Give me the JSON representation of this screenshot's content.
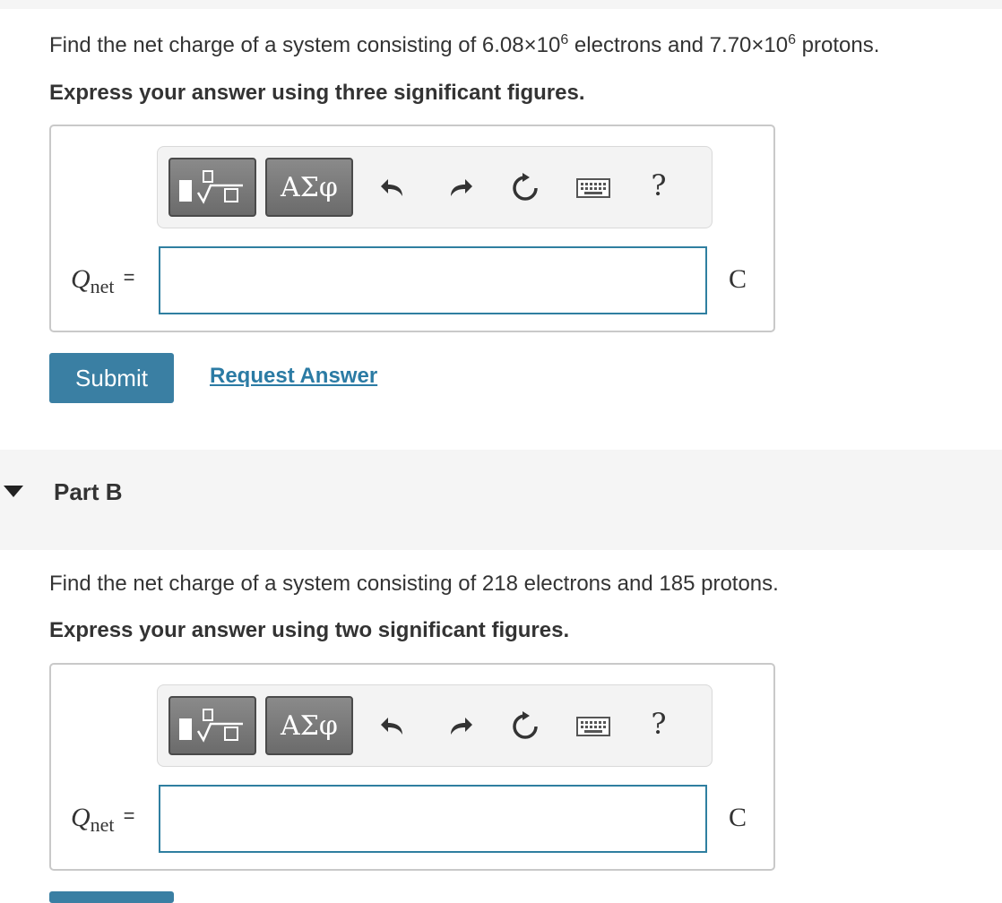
{
  "partA": {
    "question_prefix": "Find the net charge of a system consisting of 6.08×10",
    "question_exp1": "6",
    "question_mid": " electrons and 7.70×10",
    "question_exp2": "6",
    "question_suffix": " protons.",
    "instruction": "Express your answer using three significant figures.",
    "variable": "Q",
    "variable_sub": "net",
    "equals": "=",
    "answer_value": "",
    "unit": "C",
    "submit_label": "Submit",
    "request_label": "Request Answer"
  },
  "partB": {
    "title": "Part B",
    "question": "Find the net charge of a system consisting of 218 electrons and 185 protons.",
    "instruction": "Express your answer using two significant figures.",
    "variable": "Q",
    "variable_sub": "net",
    "equals": "=",
    "answer_value": "",
    "unit": "C"
  },
  "toolbar": {
    "symbols_label": "ΑΣφ",
    "help_label": "?",
    "icons": [
      "templates-icon",
      "undo-icon",
      "redo-icon",
      "reset-icon",
      "keyboard-icon",
      "help-icon"
    ]
  },
  "colors": {
    "accent": "#3a7fa3",
    "link": "#2b7ba4",
    "input_border": "#2f7fa0",
    "toolbar_button": "#777777"
  }
}
